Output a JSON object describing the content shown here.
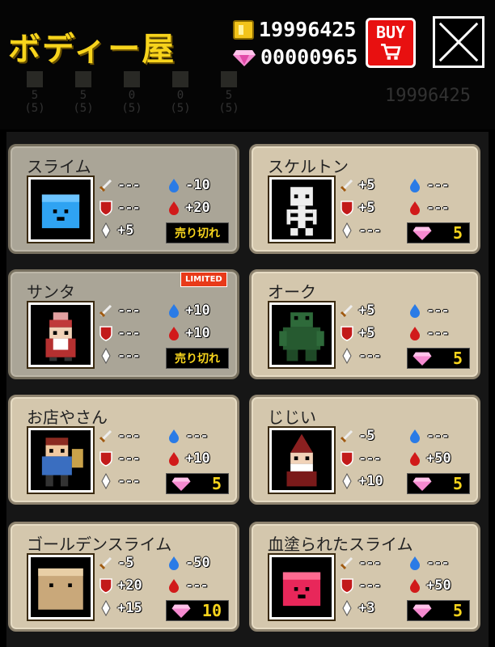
{
  "header": {
    "title": "ボディー屋",
    "gold": "19996425",
    "gems": "00000965",
    "buy_label": "BUY"
  },
  "background_strip": {
    "items": [
      {
        "value": "5",
        "sub": "(5)"
      },
      {
        "value": "5",
        "sub": "(5)"
      },
      {
        "value": "0",
        "sub": "(5)"
      },
      {
        "value": "0",
        "sub": "(5)"
      },
      {
        "value": "5",
        "sub": "(5)"
      }
    ],
    "gold": "19996425"
  },
  "items": [
    {
      "name": "スライム",
      "atk": "---",
      "def": "---",
      "spd": "+5",
      "mp": "-10",
      "hp": "+20",
      "status": "sold_out",
      "sold_label": "売り切れ",
      "price": "",
      "limited": ""
    },
    {
      "name": "スケルトン",
      "atk": "+5",
      "def": "+5",
      "spd": "---",
      "mp": "---",
      "hp": "---",
      "status": "price",
      "sold_label": "",
      "price": "5",
      "limited": ""
    },
    {
      "name": "サンタ",
      "atk": "---",
      "def": "---",
      "spd": "---",
      "mp": "+10",
      "hp": "+10",
      "status": "sold_out",
      "sold_label": "売り切れ",
      "price": "",
      "limited": "LIMITED"
    },
    {
      "name": "オーク",
      "atk": "+5",
      "def": "+5",
      "spd": "---",
      "mp": "---",
      "hp": "---",
      "status": "price",
      "sold_label": "",
      "price": "5",
      "limited": ""
    },
    {
      "name": "お店やさん",
      "atk": "---",
      "def": "---",
      "spd": "---",
      "mp": "---",
      "hp": "+10",
      "status": "price",
      "sold_label": "",
      "price": "5",
      "limited": ""
    },
    {
      "name": "じじい",
      "atk": "-5",
      "def": "---",
      "spd": "+10",
      "mp": "---",
      "hp": "+50",
      "status": "price",
      "sold_label": "",
      "price": "5",
      "limited": ""
    },
    {
      "name": "ゴールデンスライム",
      "atk": "-5",
      "def": "+20",
      "spd": "+15",
      "mp": "-50",
      "hp": "---",
      "status": "price",
      "sold_label": "",
      "price": "10",
      "limited": ""
    },
    {
      "name": "血塗られたスライム",
      "atk": "---",
      "def": "---",
      "spd": "+3",
      "mp": "---",
      "hp": "+50",
      "status": "price",
      "sold_label": "",
      "price": "5",
      "limited": ""
    }
  ],
  "colors": {
    "title": "#f7d41c",
    "buy_button": "#e81010",
    "card_bg": "#d4c7ad",
    "card_sold_bg": "#aaa597",
    "price_text": "#f7d41c"
  }
}
